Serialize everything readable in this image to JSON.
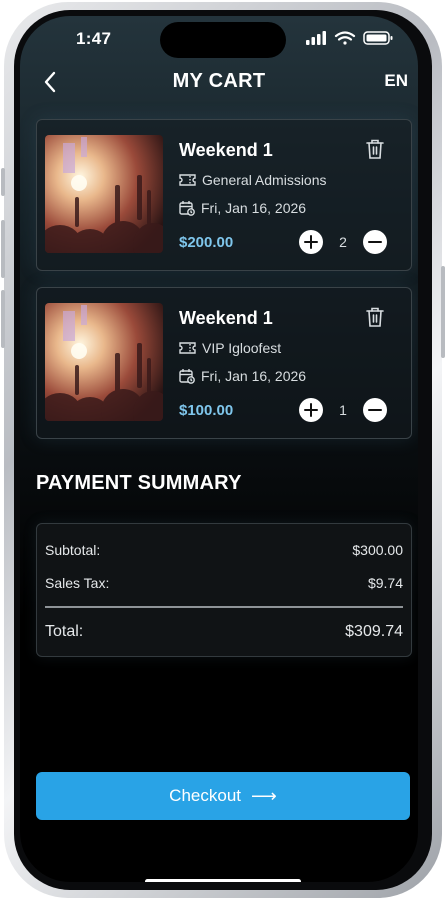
{
  "status": {
    "time": "1:47"
  },
  "header": {
    "title": "MY CART",
    "language": "EN"
  },
  "cart_items": [
    {
      "name": "Weekend 1",
      "ticket_type": "General Admissions",
      "date": "Fri, Jan 16, 2026",
      "price": "$200.00",
      "quantity": "2"
    },
    {
      "name": "Weekend 1",
      "ticket_type": "VIP Igloofest",
      "date": "Fri, Jan 16, 2026",
      "price": "$100.00",
      "quantity": "1"
    }
  ],
  "payment_summary": {
    "title": "PAYMENT SUMMARY",
    "subtotal_label": "Subtotal:",
    "subtotal_value": "$300.00",
    "tax_label": "Sales Tax:",
    "tax_value": "$9.74",
    "total_label": "Total:",
    "total_value": "$309.74"
  },
  "checkout": {
    "label": "Checkout",
    "arrow": "⟶"
  },
  "colors": {
    "accent": "#29a3e6",
    "price": "#7fc6ec",
    "background": "#000000"
  },
  "icons": [
    "back-chevron-icon",
    "trash-icon",
    "ticket-icon",
    "calendar-icon",
    "plus-icon",
    "minus-icon",
    "signal-icon",
    "wifi-icon",
    "battery-icon"
  ]
}
